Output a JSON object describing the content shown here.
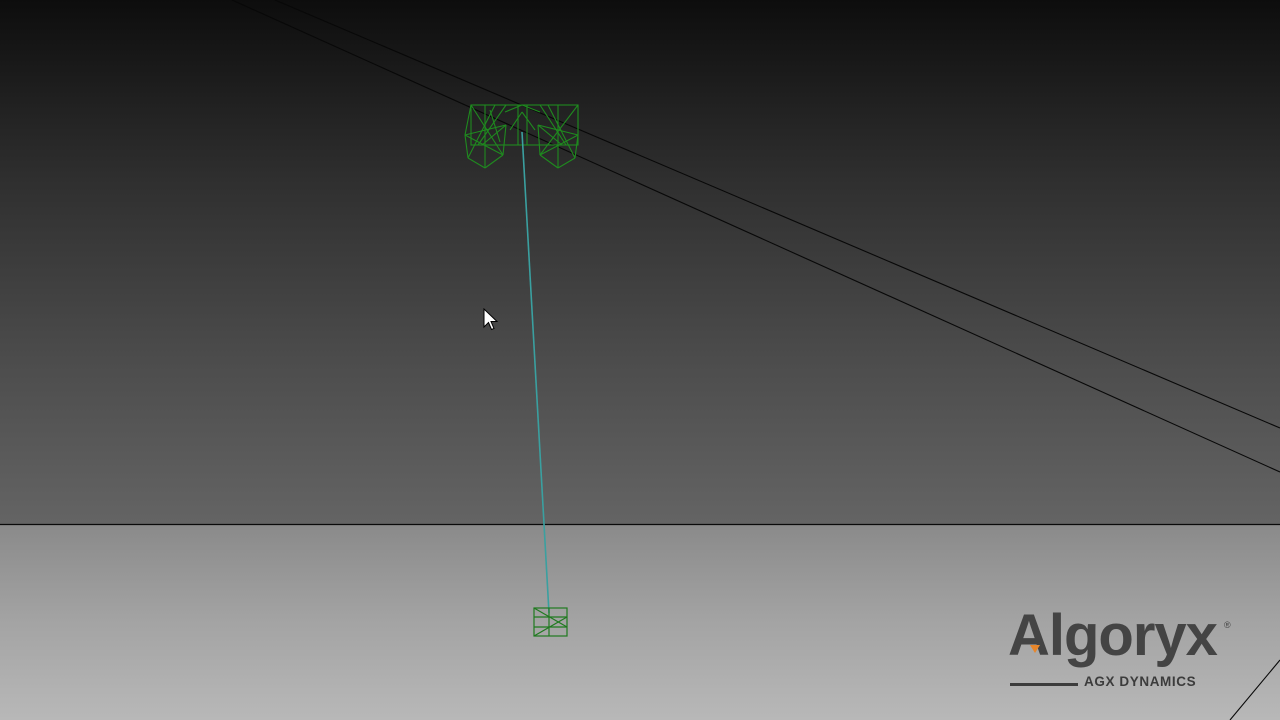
{
  "app": {
    "viewer": "AGX Dynamics 3D viewport"
  },
  "scene": {
    "objects": [
      "crane-trolley-wireframe",
      "hoist-cable",
      "suspended-load-box",
      "ground-plane",
      "rail-lines"
    ],
    "colors": {
      "wireframe": "#1f8a1f",
      "cable": "#3aa0a0",
      "horizon": "#0a0a0a"
    }
  },
  "logo": {
    "brand": "Algoryx",
    "registered": "®",
    "product": "AGX DYNAMICS"
  },
  "cursor": {
    "icon": "arrow-pointer-icon"
  }
}
